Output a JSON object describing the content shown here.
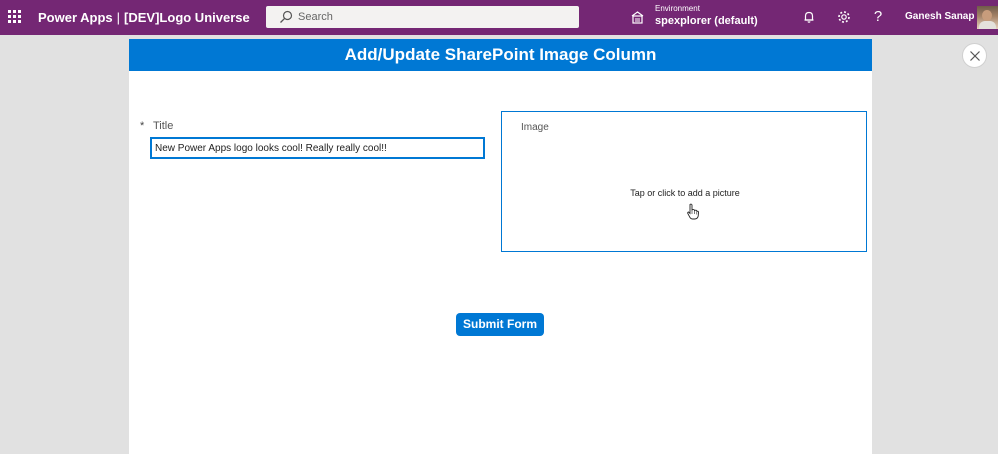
{
  "topbar": {
    "app_name": "Power Apps",
    "separator": "|",
    "app_title": "[DEV]Logo Universe",
    "search_placeholder": "Search",
    "environment_label": "Environment",
    "environment_value": "spexplorer (default)",
    "help_glyph": "?",
    "user_name": "Ganesh Sanap",
    "icons": [
      "waffle-icon",
      "search-icon",
      "environment-icon",
      "bell-icon",
      "gear-icon",
      "help-icon",
      "avatar"
    ]
  },
  "form": {
    "header": "Add/Update SharePoint Image Column",
    "title_required_marker": "*",
    "title_label": "Title",
    "title_value": "New Power Apps logo looks cool! Really really cool!!",
    "image_label": "Image",
    "image_hint": "Tap or click to add a picture",
    "submit_label": "Submit Form"
  },
  "colors": {
    "topbar": "#742774",
    "accent": "#0078d4",
    "background": "#e1e1e1"
  }
}
